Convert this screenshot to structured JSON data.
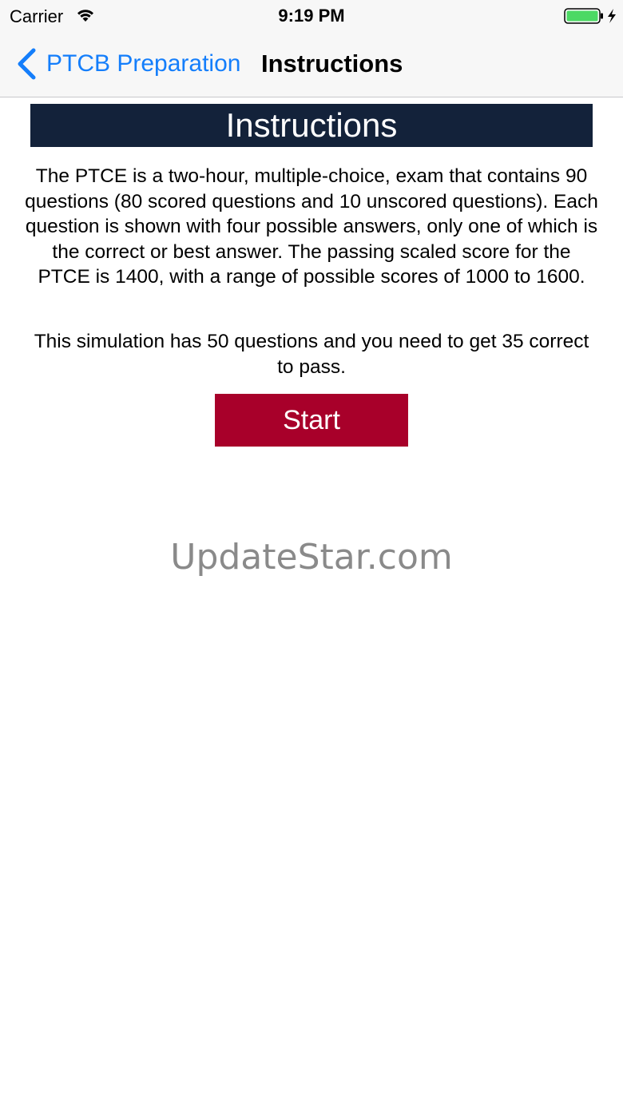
{
  "status_bar": {
    "carrier": "Carrier",
    "time": "9:19 PM",
    "wifi_icon": "wifi-icon",
    "battery_icon": "battery-charging-icon",
    "battery_color": "#4cd964"
  },
  "nav": {
    "back_label": "PTCB Preparation",
    "back_icon": "chevron-left-icon",
    "title": "Instructions",
    "accent_color": "#147efb"
  },
  "content": {
    "heading": "Instructions",
    "heading_bg": "#13223a",
    "paragraph_1": "The PTCE is a two-hour, multiple-choice, exam that contains 90 questions (80 scored questions and 10 unscored questions). Each question is shown with four possible answers, only one of which is the correct or best answer. The passing scaled score for the PTCE is 1400, with a range of possible scores of 1000 to 1600.",
    "paragraph_2": "This simulation has 50 questions and you need to get 35 correct to pass.",
    "start_label": "Start",
    "start_color": "#a8002a"
  },
  "watermark": "UpdateStar.com"
}
